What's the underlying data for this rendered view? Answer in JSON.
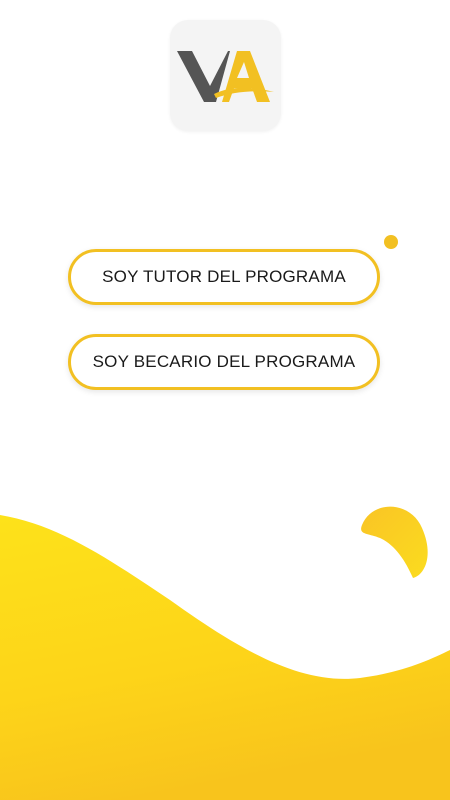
{
  "app": {
    "logo_text": "VA",
    "brand_color_dark": "#555555",
    "brand_color_accent": "#f2c022"
  },
  "actions": {
    "tutor_label": "SOY TUTOR DEL PROGRAMA",
    "becario_label": "SOY BECARIO DEL PROGRAMA"
  },
  "theme": {
    "background": "#ffffff",
    "wave_color_light": "#fddc1a",
    "wave_color_dark": "#f6c31e"
  }
}
